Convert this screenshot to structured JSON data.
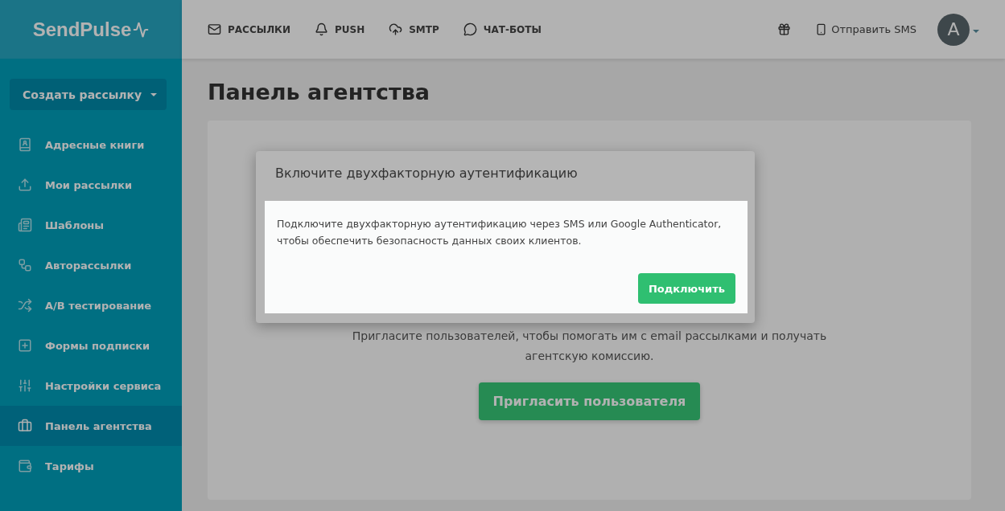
{
  "logo": {
    "text": "SendPulse"
  },
  "create_button": {
    "label": "Создать рассылку"
  },
  "sidebar": {
    "items": [
      {
        "label": "Адресные книги",
        "selected": false
      },
      {
        "label": "Мои рассылки",
        "selected": false
      },
      {
        "label": "Шаблоны",
        "selected": false
      },
      {
        "label": "Авторассылки",
        "selected": false
      },
      {
        "label": "A/B тестирование",
        "selected": false
      },
      {
        "label": "Формы подписки",
        "selected": false
      },
      {
        "label": "Настройки сервиса",
        "selected": false
      },
      {
        "label": "Панель агентства",
        "selected": true
      },
      {
        "label": "Тарифы",
        "selected": false
      }
    ]
  },
  "top_nav": [
    {
      "label": "РАССЫЛКИ"
    },
    {
      "label": "PUSH"
    },
    {
      "label": "SMTP"
    },
    {
      "label": "ЧАТ-БОТЫ"
    }
  ],
  "top_right": {
    "sms_link": "Отправить SMS",
    "avatar": "A"
  },
  "page_title": "Панель агентства",
  "card": {
    "text": "Пригласите пользователей, чтобы помогать им с email рассылками и получать агентскую комиссию.",
    "button": "Пригласить пользователя"
  },
  "modal": {
    "title": "Включите двухфакторную аутентификацию",
    "body": "Подключите двухфакторную аутентификацию через SMS или Google Authenticator, чтобы обеспечить безопасность данных своих клиентов.",
    "button": "Подключить"
  }
}
